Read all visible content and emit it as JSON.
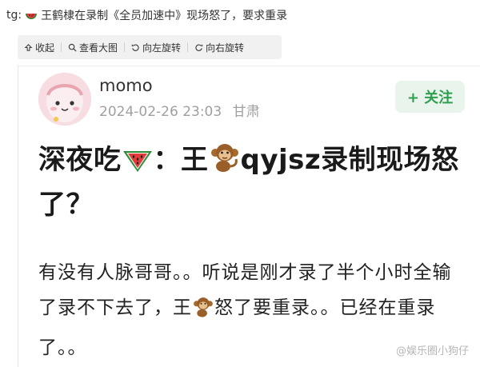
{
  "top": {
    "prefix": "tg:",
    "headline": "王鹤棣在录制《全员加速中》现场怒了，要求重录",
    "melon_icon": "watermelon-icon"
  },
  "toolbar": {
    "items": [
      {
        "label": "收起",
        "icon": "collapse-icon"
      },
      {
        "label": "查看大图",
        "icon": "search-icon"
      },
      {
        "label": "向左旋转",
        "icon": "rotate-left-icon"
      },
      {
        "label": "向右旋转",
        "icon": "rotate-right-icon"
      }
    ]
  },
  "post": {
    "username": "momo",
    "datetime": "2024-02-26 23:03",
    "location": "甘肃",
    "follow_label": "+ 关注",
    "title_part1": "深夜吃",
    "title_part2": "：王",
    "title_part3": "qyjsz录制现场怒了？",
    "body_part1": "有没有人脉哥哥。。听说是刚才录了半个小时全输了录不下去了，王",
    "body_part2": "怒了要重录。。已经在重录了。。",
    "watermark": "@娱乐圈小狗仔"
  },
  "colors": {
    "follow_bg": "#e9f5ec",
    "follow_text": "#2f9e4f",
    "meta_text": "#a0a0a0",
    "toolbar_bg": "#f1f1f1"
  }
}
